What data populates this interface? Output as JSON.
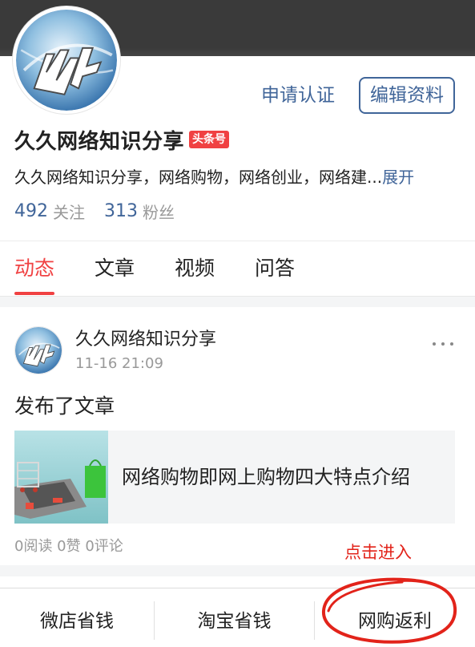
{
  "profile": {
    "avatar_icon": "globe-logo-icon",
    "certify_label": "申请认证",
    "edit_label": "编辑资料",
    "name": "久久网络知识分享",
    "badge": "头条号",
    "bio": "久久网络知识分享，网络购物，网络创业，网络建...",
    "bio_more": "展开",
    "following_count": "492",
    "following_label": "关注",
    "followers_count": "313",
    "followers_label": "粉丝"
  },
  "tabs": [
    {
      "label": "动态",
      "active": true
    },
    {
      "label": "文章",
      "active": false
    },
    {
      "label": "视频",
      "active": false
    },
    {
      "label": "问答",
      "active": false
    }
  ],
  "post": {
    "author": "久久网络知识分享",
    "time": "11-16 21:09",
    "action": "发布了文章",
    "article_title": "网络购物即网上购物四大特点介绍",
    "stats": "0阅读 0赞 0评论",
    "more_icon": "more-dots-icon"
  },
  "annotation": {
    "note": "点击进入",
    "color": "#e2231a"
  },
  "bottom_bar": [
    {
      "label": "微店省钱"
    },
    {
      "label": "淘宝省钱"
    },
    {
      "label": "网购返利"
    }
  ],
  "colors": {
    "accent_blue": "#406599",
    "accent_red": "#f04142",
    "header_dark": "#3a3a3a"
  }
}
